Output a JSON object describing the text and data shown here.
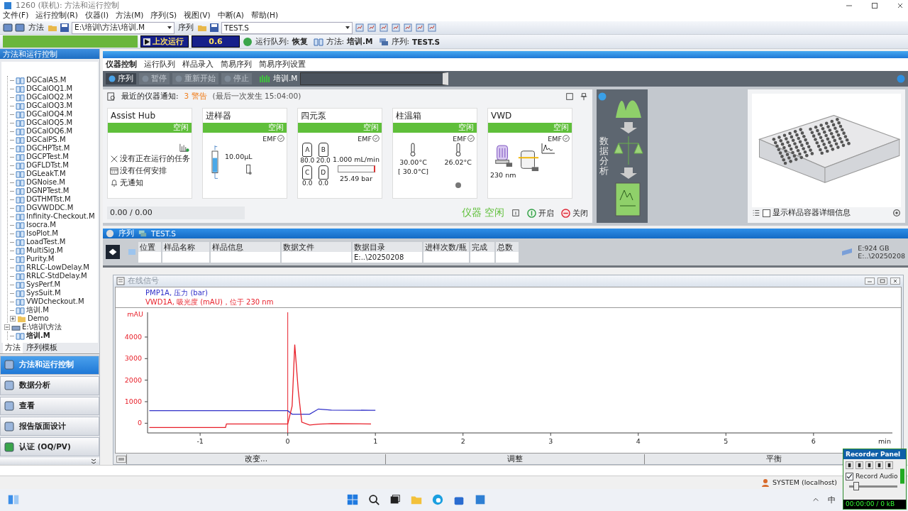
{
  "window": {
    "title": "1260 (联机): 方法和运行控制"
  },
  "menu": [
    "文件(F)",
    "运行控制(R)",
    "仪器(I)",
    "方法(M)",
    "序列(S)",
    "视图(V)",
    "中断(A)",
    "帮助(H)"
  ],
  "toolbar": {
    "method_label": "方法",
    "method_path": "E:\\培训\\方法\\培训.M",
    "sequence_label": "序列",
    "sequence_file": "TEST.S"
  },
  "run_bar": {
    "last_run": "上次运行",
    "value": "0.6",
    "queue_label": "运行队列:",
    "queue_value": "恢复",
    "method_label": "方法:",
    "method_value": "培训.M",
    "sequence_label": "序列:",
    "sequence_value": "TEST.S"
  },
  "side_panel": {
    "title": "方法和运行控制",
    "tree": [
      {
        "expanded": true,
        "children": [
          {
            "label": "DGCalAS.M",
            "kind": "method",
            "selected": false
          },
          {
            "label": "DGCalOQ1.M",
            "kind": "method",
            "selected": false
          },
          {
            "label": "DGCalOQ2.M",
            "kind": "method",
            "selected": false
          },
          {
            "label": "DGCalOQ3.M",
            "kind": "method",
            "selected": false
          },
          {
            "label": "DGCalOQ4.M",
            "kind": "method",
            "selected": false
          },
          {
            "label": "DGCalOQ5.M",
            "kind": "method",
            "selected": false
          },
          {
            "label": "DGCalOQ6.M",
            "kind": "method",
            "selected": false
          },
          {
            "label": "DGCalPS.M",
            "kind": "method",
            "selected": false
          },
          {
            "label": "DGCHPTst.M",
            "kind": "method",
            "selected": false
          },
          {
            "label": "DGCPTest.M",
            "kind": "method",
            "selected": false
          },
          {
            "label": "DGFLDTst.M",
            "kind": "method",
            "selected": false
          },
          {
            "label": "DGLeakT.M",
            "kind": "method",
            "selected": false
          },
          {
            "label": "DGNoise.M",
            "kind": "method",
            "selected": false
          },
          {
            "label": "DGNPTest.M",
            "kind": "method",
            "selected": false
          },
          {
            "label": "DGTHMTst.M",
            "kind": "method",
            "selected": false
          },
          {
            "label": "DGVWDDC.M",
            "kind": "method",
            "selected": false
          },
          {
            "label": "Infinity-Checkout.M",
            "kind": "method",
            "selected": false
          },
          {
            "label": "Isocra.M",
            "kind": "method",
            "selected": false
          },
          {
            "label": "IsoPlot.M",
            "kind": "method",
            "selected": false
          },
          {
            "label": "LoadTest.M",
            "kind": "method",
            "selected": false
          },
          {
            "label": "MultiSig.M",
            "kind": "method",
            "selected": false
          },
          {
            "label": "Purity.M",
            "kind": "method",
            "selected": false
          },
          {
            "label": "RRLC-LowDelay.M",
            "kind": "method",
            "selected": false
          },
          {
            "label": "RRLC-StdDelay.M",
            "kind": "method",
            "selected": false
          },
          {
            "label": "SysPerf.M",
            "kind": "method",
            "selected": false
          },
          {
            "label": "SysSuit.M",
            "kind": "method",
            "selected": false
          },
          {
            "label": "VWDcheckout.M",
            "kind": "method",
            "selected": false
          },
          {
            "label": "培训.M",
            "kind": "method",
            "selected": false
          },
          {
            "label": "Demo",
            "kind": "folder",
            "expanded": false,
            "selected": false
          }
        ]
      },
      {
        "label": "E:\\培训\\方法",
        "kind": "drive",
        "expanded": true,
        "children": [
          {
            "label": "培训.M",
            "kind": "method",
            "selected": true
          }
        ]
      }
    ],
    "tabs": [
      {
        "label": "方法",
        "selected": true
      },
      {
        "label": "序列模板",
        "selected": false
      }
    ],
    "nav": [
      {
        "label": "方法和运行控制",
        "selected": true
      },
      {
        "label": "数据分析",
        "selected": false
      },
      {
        "label": "查看",
        "selected": false
      },
      {
        "label": "报告版面设计",
        "selected": false
      },
      {
        "label": "认证 (OQ/PV)",
        "selected": false
      }
    ]
  },
  "main_tabs": [
    {
      "label": "仪器控制",
      "selected": true
    },
    {
      "label": "运行队列",
      "selected": false
    },
    {
      "label": "样品录入",
      "selected": false
    },
    {
      "label": "简易序列",
      "selected": false
    },
    {
      "label": "简易序列设置",
      "selected": false
    }
  ],
  "control_bar": {
    "buttons": [
      {
        "label": "序列",
        "disabled": false
      },
      {
        "label": "暂停",
        "disabled": true
      },
      {
        "label": "重新开始",
        "disabled": true
      },
      {
        "label": "停止",
        "disabled": true
      }
    ],
    "method": "培训.M"
  },
  "notifications": {
    "label": "最近的仪器通知:",
    "count": "3 警告",
    "last": "(最后一次发生  15:04:00)"
  },
  "modules": [
    {
      "kind": "hub",
      "title": "Assist Hub",
      "status": "空闲",
      "items": [
        "没有正在运行的任务",
        "没有任何安排",
        "无通知"
      ]
    },
    {
      "kind": "sampler",
      "title": "进样器",
      "status": "空闲",
      "emf": "EMF",
      "volume": "10.00µL"
    },
    {
      "kind": "pump",
      "title": "四元泵",
      "status": "空闲",
      "emf": "EMF",
      "bottles": [
        {
          "label": "A",
          "value": "80.0"
        },
        {
          "label": "B",
          "value": "20.0"
        },
        {
          "label": "C",
          "value": "0.0"
        },
        {
          "label": "D",
          "value": "0.0"
        }
      ],
      "flow": "1.000 mL/min",
      "pressure": "25.49 bar"
    },
    {
      "kind": "oven",
      "title": "柱温箱",
      "status": "空闲",
      "emf": "EMF",
      "temperature": "30.00°C",
      "setpoint": "[  30.0°C]",
      "actual": "26.02°C"
    },
    {
      "kind": "detector",
      "title": "VWD",
      "status": "空闲",
      "emf": "EMF",
      "wavelength": "230 nm"
    }
  ],
  "instrument_footer": {
    "progress": "0.00 / 0.00",
    "status": "仪器 空闲",
    "on": "开启",
    "off": "关闭"
  },
  "data_analysis": {
    "title": "数据分析"
  },
  "tray": {
    "option": {
      "label": "显示样品容器详细信息",
      "checked": false
    }
  },
  "sequence": {
    "title": "序列",
    "file": "TEST.S",
    "columns": [
      "位置",
      "样品名称",
      "样品信息",
      "数据文件",
      "数据目录",
      "进样次数/瓶",
      "完成",
      "总数"
    ],
    "rows": [
      {
        "cells": [
          null,
          null,
          null,
          null,
          "E:..\\20250208",
          null,
          null,
          null
        ]
      }
    ],
    "disk": [
      "E:924 GB",
      "E:..\\20250208"
    ]
  },
  "signal_window": {
    "title": "在线信号",
    "chart_data": {
      "type": "line",
      "ylabel": "mAU",
      "xlabel": "min",
      "x": [
        -1.58,
        -0.71,
        -0.7,
        0,
        0.05,
        0.08,
        0.12,
        0.16,
        0.25,
        0.35,
        0.5,
        0.95,
        1.0
      ],
      "series": [
        {
          "name": "PMP1A, 压力 (bar)",
          "color": "#2f2fc8",
          "values": [
            580,
            580,
            580,
            580,
            420,
            420,
            420,
            420,
            420,
            660,
            610,
            600,
            600
          ]
        },
        {
          "name": "VWD1A, 吸光度 (mAU)，位于 230 nm",
          "color": "#e8202a",
          "values": [
            -200,
            -200,
            -30,
            -30,
            800,
            3650,
            1500,
            50,
            -80,
            -40,
            -20,
            -30,
            null
          ]
        }
      ],
      "xlim": [
        -1.6,
        6.9
      ],
      "ylim": [
        -450,
        5150
      ],
      "xticks": [
        -1,
        0,
        1,
        2,
        3,
        4,
        5,
        6
      ],
      "yticks": [
        0,
        1000,
        2000,
        3000,
        4000
      ],
      "ref_lines": [
        {
          "axis": "x",
          "value": 0,
          "color": "#e8202a"
        }
      ]
    },
    "buttons": [
      "改变...",
      "调整",
      "平衡"
    ]
  },
  "status_bar": {
    "user": "SYSTEM (localhost)"
  },
  "taskbar": {
    "input_method": "中"
  },
  "recorder": {
    "title": "Recorder Panel",
    "record_audio": {
      "label": "Record Audio",
      "checked": true
    },
    "volume": {
      "level": 0.1
    },
    "time": "00:00:00 / 0 kB"
  }
}
